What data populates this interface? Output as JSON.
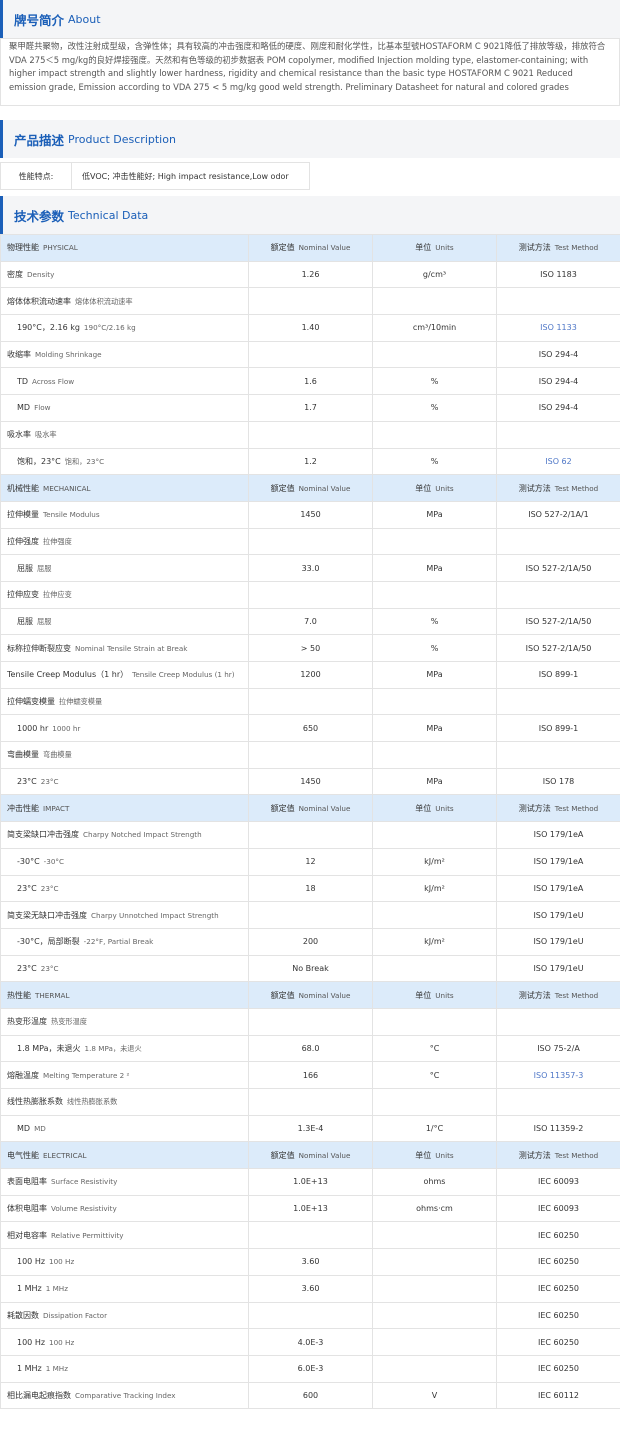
{
  "about": {
    "title_zh": "牌号简介",
    "title_en": "About",
    "text": "聚甲醛共聚物，改性注射成型级，含弹性体；具有较高的冲击强度和略低的硬度、刚度和耐化学性，比基本型號HOSTAFORM C 9021降低了排放等级，排放符合VDA 275＜5 mg/kg的良好焊接强度。天然和有色等级的初步数据表 POM copolymer, modified Injection molding type, elastomer-containing; with higher impact strength and slightly lower hardness, rigidity and chemical resistance than the basic type HOSTAFORM C 9021 Reduced emission grade, Emission according to VDA 275 < 5 mg/kg good weld strength. Preliminary Datasheet for natural and colored grades"
  },
  "product": {
    "title_zh": "产品描述",
    "title_en": "Product Description",
    "label": "性能特点:",
    "value": "低VOC; 冲击性能好;   High impact resistance,Low odor"
  },
  "tech": {
    "title_zh": "技术参数",
    "title_en": "Technical Data"
  },
  "rows": [
    {
      "type": "cat",
      "zh": "物理性能",
      "en": "PHYSICAL",
      "h1_zh": "额定值",
      "h1_en": "Nominal Value",
      "h2_zh": "单位",
      "h2_en": "Units",
      "h3_zh": "测试方法",
      "h3_en": "Test Method"
    },
    {
      "type": "row",
      "zh": "密度",
      "en": "Density",
      "value": "1.26",
      "unit": "g/cm³",
      "method": "ISO 1183"
    },
    {
      "type": "row",
      "zh": "熔体体积流动速率",
      "en": "熔体体积流动速率",
      "value": "",
      "unit": "",
      "method": ""
    },
    {
      "type": "sub",
      "zh": "190°C，2.16 kg",
      "en": "190°C/2.16 kg",
      "value": "1.40",
      "unit": "cm³/10min",
      "method": "ISO 1133",
      "link": true
    },
    {
      "type": "row",
      "zh": "收缩率",
      "en": "Molding Shrinkage",
      "value": "",
      "unit": "",
      "method": "ISO 294-4"
    },
    {
      "type": "sub",
      "zh": "TD",
      "en": "Across Flow",
      "value": "1.6",
      "unit": "%",
      "method": "ISO 294-4"
    },
    {
      "type": "sub",
      "zh": "MD",
      "en": "Flow",
      "value": "1.7",
      "unit": "%",
      "method": "ISO 294-4"
    },
    {
      "type": "row",
      "zh": "吸水率",
      "en": "吸水率",
      "value": "",
      "unit": "",
      "method": ""
    },
    {
      "type": "sub",
      "zh": "饱和，23°C",
      "en": "饱和，23°C",
      "value": "1.2",
      "unit": "%",
      "method": "ISO 62",
      "link": true
    },
    {
      "type": "cat",
      "zh": "机械性能",
      "en": "MECHANICAL",
      "h1_zh": "额定值",
      "h1_en": "Nominal Value",
      "h2_zh": "单位",
      "h2_en": "Units",
      "h3_zh": "测试方法",
      "h3_en": "Test Method"
    },
    {
      "type": "row",
      "zh": "拉伸模量",
      "en": "Tensile Modulus",
      "value": "1450",
      "unit": "MPa",
      "method": "ISO 527-2/1A/1"
    },
    {
      "type": "row",
      "zh": "拉伸强度",
      "en": "拉伸强度",
      "value": "",
      "unit": "",
      "method": ""
    },
    {
      "type": "sub",
      "zh": "屈服",
      "en": "屈服",
      "value": "33.0",
      "unit": "MPa",
      "method": "ISO 527-2/1A/50"
    },
    {
      "type": "row",
      "zh": "拉伸应变",
      "en": "拉伸应变",
      "value": "",
      "unit": "",
      "method": ""
    },
    {
      "type": "sub",
      "zh": "屈服",
      "en": "屈服",
      "value": "7.0",
      "unit": "%",
      "method": "ISO 527-2/1A/50"
    },
    {
      "type": "row",
      "zh": "标称拉伸断裂应变",
      "en": "Nominal Tensile Strain at Break",
      "value": "> 50",
      "unit": "%",
      "method": "ISO 527-2/1A/50"
    },
    {
      "type": "row",
      "zh": "Tensile Creep Modulus（1 hr）",
      "en": "Tensile Creep Modulus (1 hr)",
      "value": "1200",
      "unit": "MPa",
      "method": "ISO 899-1",
      "wrap": true
    },
    {
      "type": "row",
      "zh": "拉伸蠕变模量",
      "en": "拉伸蠕变模量",
      "value": "",
      "unit": "",
      "method": ""
    },
    {
      "type": "sub",
      "zh": "1000 hr",
      "en": "1000 hr",
      "value": "650",
      "unit": "MPa",
      "method": "ISO 899-1"
    },
    {
      "type": "row",
      "zh": "弯曲模量",
      "en": "弯曲模量",
      "value": "",
      "unit": "",
      "method": ""
    },
    {
      "type": "sub",
      "zh": "23°C",
      "en": "23°C",
      "value": "1450",
      "unit": "MPa",
      "method": "ISO 178"
    },
    {
      "type": "cat",
      "zh": "冲击性能",
      "en": "IMPACT",
      "h1_zh": "额定值",
      "h1_en": "Nominal Value",
      "h2_zh": "单位",
      "h2_en": "Units",
      "h3_zh": "测试方法",
      "h3_en": "Test Method"
    },
    {
      "type": "row",
      "zh": "简支梁缺口冲击强度",
      "en": "Charpy Notched Impact Strength",
      "value": "",
      "unit": "",
      "method": "ISO 179/1eA"
    },
    {
      "type": "sub",
      "zh": "-30°C",
      "en": "-30°C",
      "value": "12",
      "unit": "kJ/m²",
      "method": "ISO 179/1eA"
    },
    {
      "type": "sub",
      "zh": "23°C",
      "en": "23°C",
      "value": "18",
      "unit": "kJ/m²",
      "method": "ISO 179/1eA"
    },
    {
      "type": "row",
      "zh": "简支梁无缺口冲击强度",
      "en": "Charpy Unnotched Impact Strength",
      "value": "",
      "unit": "",
      "method": "ISO 179/1eU"
    },
    {
      "type": "sub",
      "zh": "-30°C，局部断裂",
      "en": "-22°F, Partial Break",
      "value": "200",
      "unit": "kJ/m²",
      "method": "ISO 179/1eU"
    },
    {
      "type": "sub",
      "zh": "23°C",
      "en": "23°C",
      "value": "No Break",
      "unit": "",
      "method": "ISO 179/1eU"
    },
    {
      "type": "cat",
      "zh": "热性能",
      "en": "THERMAL",
      "h1_zh": "额定值",
      "h1_en": "Nominal Value",
      "h2_zh": "单位",
      "h2_en": "Units",
      "h3_zh": "测试方法",
      "h3_en": "Test Method"
    },
    {
      "type": "row",
      "zh": "热变形温度",
      "en": "热变形温度",
      "value": "",
      "unit": "",
      "method": ""
    },
    {
      "type": "sub",
      "zh": "1.8 MPa，未退火",
      "en": "1.8 MPa，未退火",
      "value": "68.0",
      "unit": "°C",
      "method": "ISO 75-2/A"
    },
    {
      "type": "row",
      "zh": "熔融温度",
      "en": "Melting Temperature   2 ²",
      "value": "166",
      "unit": "°C",
      "method": "ISO 11357-3",
      "link": true
    },
    {
      "type": "row",
      "zh": "线性热膨胀系数",
      "en": "线性热膨胀系数",
      "value": "",
      "unit": "",
      "method": ""
    },
    {
      "type": "sub",
      "zh": "MD",
      "en": "MD",
      "value": "1.3E-4",
      "unit": "1/°C",
      "method": "ISO 11359-2"
    },
    {
      "type": "cat",
      "zh": "电气性能",
      "en": "ELECTRICAL",
      "h1_zh": "额定值",
      "h1_en": "Nominal Value",
      "h2_zh": "单位",
      "h2_en": "Units",
      "h3_zh": "测试方法",
      "h3_en": "Test Method"
    },
    {
      "type": "row",
      "zh": "表面电阻率",
      "en": "Surface Resistivity",
      "value": "1.0E+13",
      "unit": "ohms",
      "method": "IEC 60093"
    },
    {
      "type": "row",
      "zh": "体积电阻率",
      "en": "Volume Resistivity",
      "value": "1.0E+13",
      "unit": "ohms·cm",
      "method": "IEC 60093"
    },
    {
      "type": "row",
      "zh": "相对电容率",
      "en": "Relative Permittivity",
      "value": "",
      "unit": "",
      "method": "IEC 60250"
    },
    {
      "type": "sub",
      "zh": "100 Hz",
      "en": "100 Hz",
      "value": "3.60",
      "unit": "",
      "method": "IEC 60250"
    },
    {
      "type": "sub",
      "zh": "1 MHz",
      "en": "1 MHz",
      "value": "3.60",
      "unit": "",
      "method": "IEC 60250"
    },
    {
      "type": "row",
      "zh": "耗散因数",
      "en": "Dissipation Factor",
      "value": "",
      "unit": "",
      "method": "IEC 60250"
    },
    {
      "type": "sub",
      "zh": "100 Hz",
      "en": "100 Hz",
      "value": "4.0E-3",
      "unit": "",
      "method": "IEC 60250"
    },
    {
      "type": "sub",
      "zh": "1 MHz",
      "en": "1 MHz",
      "value": "6.0E-3",
      "unit": "",
      "method": "IEC 60250"
    },
    {
      "type": "row",
      "zh": "相比漏电起痕指数",
      "en": "Comparative Tracking Index",
      "value": "600",
      "unit": "V",
      "method": "IEC 60112"
    }
  ]
}
